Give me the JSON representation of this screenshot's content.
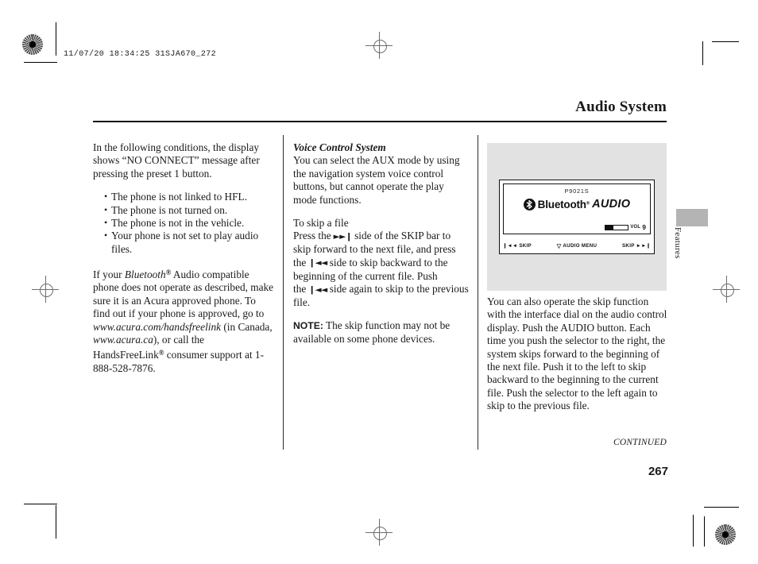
{
  "page": {
    "slug": "11/07/20 18:34:25 31SJA670_272",
    "chapter_title": "Audio System",
    "continued_label": "CONTINUED",
    "folio": "267",
    "side_tab_label": "Features"
  },
  "column_left": {
    "intro": "In the following conditions, the display shows “NO CONNECT” message after pressing the preset 1 button.",
    "bullets": [
      "The phone is not linked to HFL.",
      "The phone is not turned on.",
      "The phone is not in the vehicle.",
      "Your phone is not set to play audio files."
    ],
    "bluetooth_para": {
      "part1": "If your ",
      "trademark": "Bluetooth",
      "reg": "®",
      "part2": " Audio compatible phone does not operate as described, make sure it is an Acura approved phone. To find out if your phone is approved, go to ",
      "url_us": "www.acura.com/handsfreelink",
      "part3": " (in Canada, ",
      "url_ca": "www.acura.ca",
      "part4": "), or call the HandsFreeLink",
      "reg2": "®",
      "part5": " consumer support at 1-888-528-7876."
    }
  },
  "column_middle": {
    "heading": "Voice Control System",
    "body": "You can select the AUX mode by using the navigation system voice control buttons, but cannot operate the play mode functions.",
    "subheading": "To skip a file",
    "skip_text": {
      "p1": "Press the",
      "icon_forward": "►►❙",
      "p2": "side of the SKIP bar to skip forward to the next file, and press the",
      "icon_back": "❙◄◄",
      "p3": "side to skip backward to the beginning of the current file. Push the",
      "icon_back2": "❙◄◄",
      "p4": "side again to skip to the previous file."
    },
    "note_label": "NOTE:",
    "note_body": " The skip function may not be available on some phone devices."
  },
  "column_right": {
    "body": "You can also operate the skip function with the interface dial on the audio control display. Push the AUDIO button. Each time you push the selector to the right, the system skips forward to the beginning of the next file. Push it to the left to skip backward to the beginning to the current file. Push the selector to the left again to skip to the previous file."
  },
  "figure": {
    "model_code": "P9021S",
    "bluetooth_word": "Bluetooth",
    "bluetooth_reg": "®",
    "audio_word": "AUDIO",
    "vol_label": "VOL",
    "vol_level": "9",
    "soft_left_icon": "❙◄◄",
    "soft_left_label": "SKIP",
    "soft_center_icon": "▽",
    "soft_center_label": "AUDIO MENU",
    "soft_right_label": "SKIP",
    "soft_right_icon": "►►❙"
  }
}
